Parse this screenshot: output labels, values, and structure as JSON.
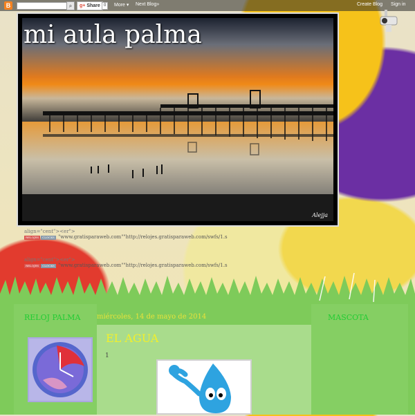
{
  "navbar": {
    "logo": "B",
    "share_label": "Share",
    "share_count": "0",
    "more_label": "More ▾",
    "next_label": "Next Blog»",
    "create_label": "Create Blog",
    "signin_label": "Sign in"
  },
  "header": {
    "title": "mi aula palma",
    "signature": "Alejja"
  },
  "widgets": {
    "line_a": "align=\"cent\"><er\">",
    "line_b": "\"www.gratisparaweb.com\"\"http://relojes.gratisparaweb.com/swfs/1.s",
    "line_c": "align=\"cent\"><er\">",
    "line_d": "\"www.gratisparaweb.com\"\"http://relojes.gratisparaweb.com/swfs/1.s"
  },
  "sidebar_left": {
    "heading": "RELOJ PALMA"
  },
  "sidebar_right": {
    "heading": "MASCOTA"
  },
  "post": {
    "date": "miércoles, 14 de mayo de 2014",
    "title": "EL AGUA",
    "number": "1"
  },
  "colors": {
    "heading_green": "#22cc33",
    "post_yellow": "#f2ef2c",
    "navbar_orange": "#f58220"
  }
}
